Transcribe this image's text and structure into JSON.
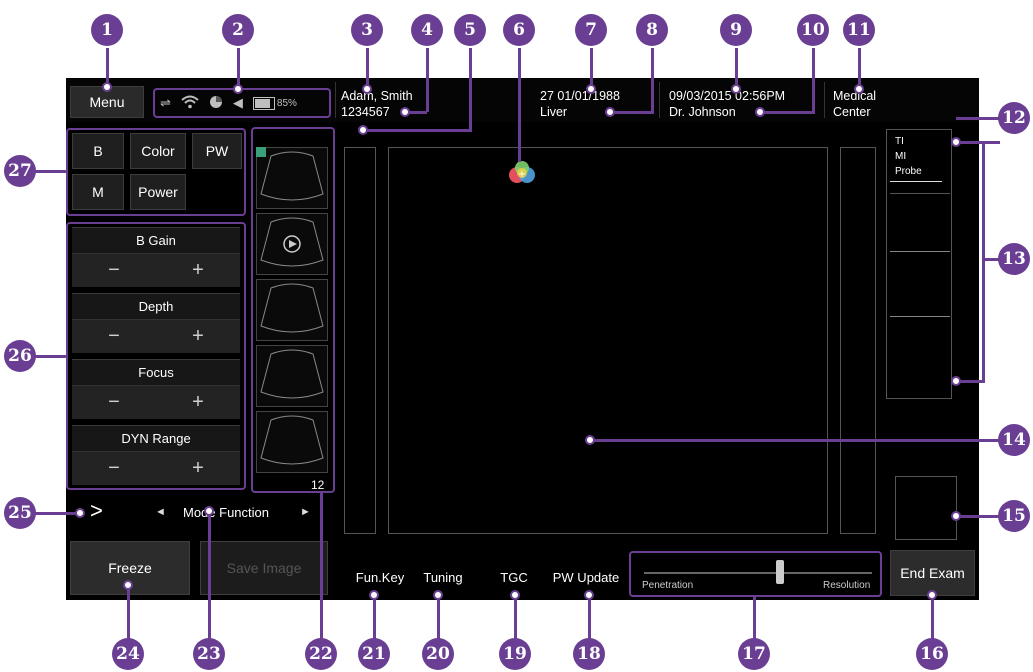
{
  "header": {
    "menu_label": "Menu",
    "battery": "85%",
    "patient_name": "Adam, Smith",
    "patient_id": "1234567",
    "age_dob": "27 01/01/1988",
    "exam_type": "Liver",
    "datetime": "09/03/2015 02:56PM",
    "doctor": "Dr. Johnson",
    "facility_line1": "Medical",
    "facility_line2": "Center"
  },
  "mode_buttons": [
    "B",
    "Color",
    "PW",
    "M",
    "Power"
  ],
  "controls": [
    {
      "title": "B Gain",
      "minus": "−",
      "plus": "+"
    },
    {
      "title": "Depth",
      "minus": "−",
      "plus": "+"
    },
    {
      "title": "Focus",
      "minus": "−",
      "plus": "+"
    },
    {
      "title": "DYN Range",
      "minus": "−",
      "plus": "+"
    }
  ],
  "thumbnails": {
    "count": "12"
  },
  "mode_function": {
    "expand": ">",
    "prev": "◄",
    "label": "Mode Function",
    "next": "►"
  },
  "actions": {
    "freeze": "Freeze",
    "save_image": "Save Image",
    "end_exam": "End Exam"
  },
  "bottom_bar": {
    "fun_key": "Fun.Key",
    "tuning": "Tuning",
    "tgc": "TGC",
    "pw_update": "PW Update",
    "penetration": "Penetration",
    "resolution": "Resolution",
    "slider_value": 0.6
  },
  "right_panel": {
    "ti": "TI",
    "mi": "MI",
    "probe": "Probe"
  },
  "callouts": [
    "1",
    "2",
    "3",
    "4",
    "5",
    "6",
    "7",
    "8",
    "9",
    "10",
    "11",
    "12",
    "13",
    "14",
    "15",
    "16",
    "17",
    "18",
    "19",
    "20",
    "21",
    "22",
    "23",
    "24",
    "25",
    "26",
    "27"
  ],
  "colors": {
    "accent": "#6a3f93",
    "screen": "#000000"
  }
}
